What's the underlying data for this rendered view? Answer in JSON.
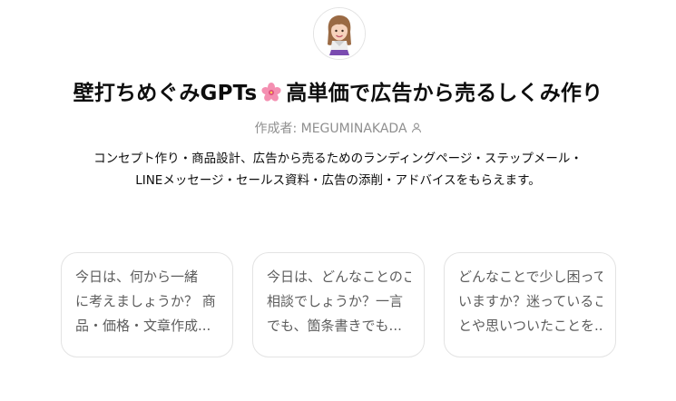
{
  "gpt": {
    "title_prefix": "壁打ちめぐみGPTs",
    "title_suffix": "高単価で広告から売るしくみ作り",
    "author_label": "作成者: MEGUMINAKADA",
    "description_lines": [
      "コンセプト作り・商品設計、広告から売るためのランディングページ・ステップメール・",
      "LINEメッセージ・セールス資料・広告の添削・アドバイスをもらえます。"
    ]
  },
  "icons": {
    "avatar": "avatar-image",
    "title_emoji": "cherry-blossom-icon",
    "author_icon": "person-icon"
  },
  "conversation_starters": [
    {
      "lines": [
        "今日は、何から一緒",
        "に考えましょうか？ 商",
        "品・価格・文章作成..."
      ]
    },
    {
      "lines": [
        "今日は、どんなことのご",
        "相談でしょうか？一言",
        "でも、箇条書きでも..."
      ]
    },
    {
      "lines": [
        "どんなことで少し困って",
        "いますか？迷っているこ",
        "とや思いついたことを..."
      ]
    }
  ],
  "colors": {
    "text_primary": "#0d0d0d",
    "text_secondary": "#8f8f8f",
    "card_text": "#5d5d5d",
    "card_border": "#e3e3e3",
    "flower_pink": "#f48fb1"
  }
}
